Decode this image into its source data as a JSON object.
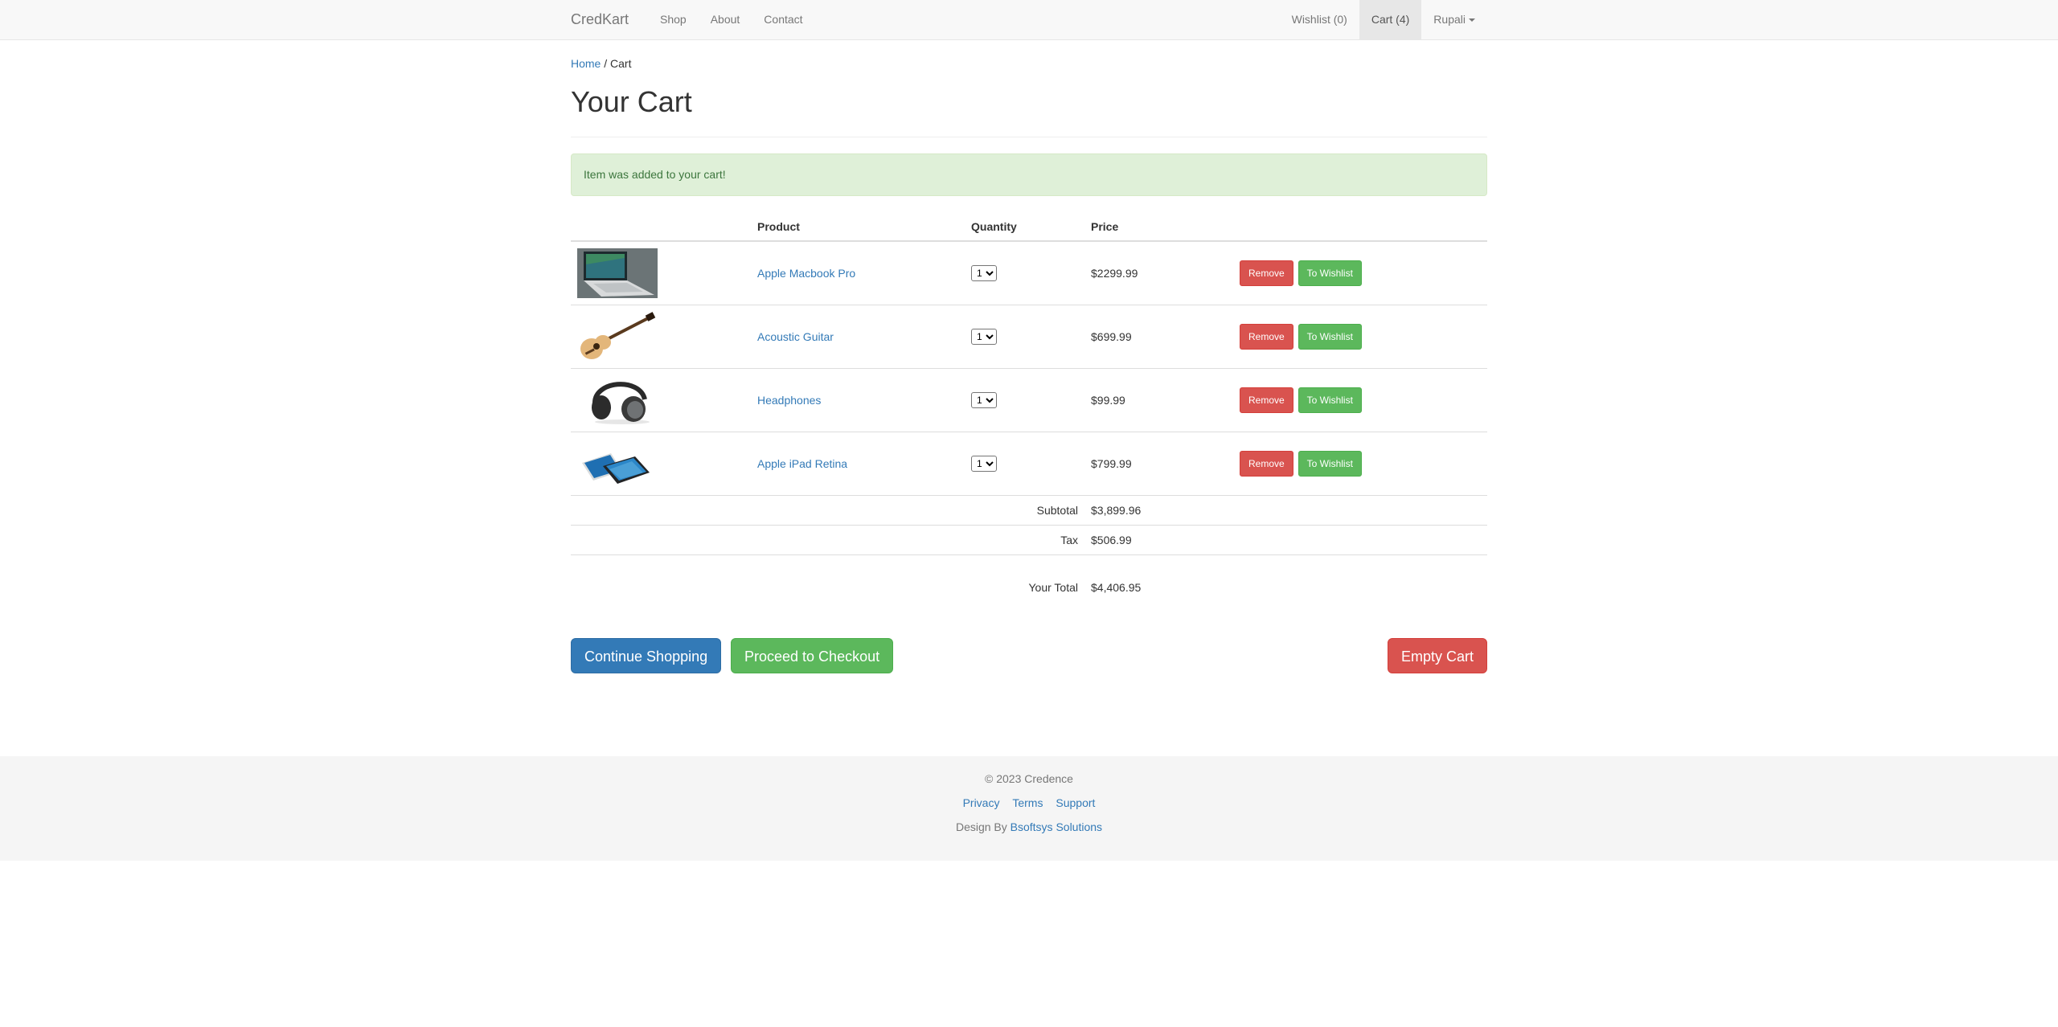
{
  "navbar": {
    "brand": "CredKart",
    "links": [
      {
        "label": "Shop"
      },
      {
        "label": "About"
      },
      {
        "label": "Contact"
      }
    ],
    "wishlist": "Wishlist (0)",
    "cart": "Cart (4)",
    "user": "Rupali"
  },
  "breadcrumb": {
    "home": "Home",
    "separator": "/",
    "current": "Cart"
  },
  "page_title": "Your Cart",
  "alert": "Item was added to your cart!",
  "table": {
    "headers": {
      "image": "",
      "product": "Product",
      "quantity": "Quantity",
      "price": "Price"
    },
    "items": [
      {
        "name": "Apple Macbook Pro",
        "qty": "1",
        "price": "$2299.99",
        "image": "laptop-image"
      },
      {
        "name": "Acoustic Guitar",
        "qty": "1",
        "price": "$699.99",
        "image": "guitar-image"
      },
      {
        "name": "Headphones",
        "qty": "1",
        "price": "$99.99",
        "image": "headphones-image"
      },
      {
        "name": "Apple iPad Retina",
        "qty": "1",
        "price": "$799.99",
        "image": "tablet-image"
      }
    ],
    "remove_label": "Remove",
    "wishlist_label": "To Wishlist"
  },
  "summary": {
    "subtotal_label": "Subtotal",
    "subtotal": "$3,899.96",
    "tax_label": "Tax",
    "tax": "$506.99",
    "total_label": "Your Total",
    "total": "$4,406.95"
  },
  "actions": {
    "continue": "Continue Shopping",
    "checkout": "Proceed to Checkout",
    "empty": "Empty Cart"
  },
  "footer": {
    "copyright": "© 2023 Credence",
    "links": [
      "Privacy",
      "Terms",
      "Support"
    ],
    "design_by": "Design By",
    "designer": "Bsoftsys Solutions"
  },
  "colors": {
    "link": "#337ab7",
    "danger": "#d9534f",
    "success": "#5cb85c",
    "primary": "#337ab7",
    "alert_bg": "#dff0d8"
  }
}
